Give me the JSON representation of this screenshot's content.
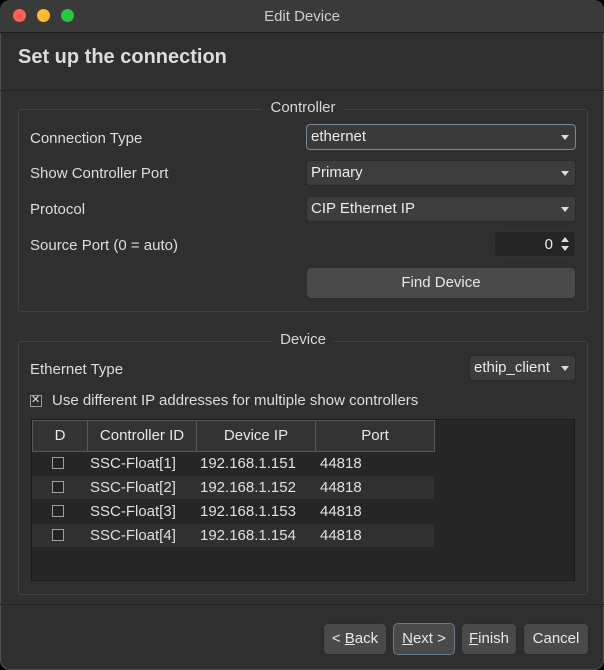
{
  "window": {
    "title": "Edit Device"
  },
  "page": {
    "title": "Set up the connection"
  },
  "controller": {
    "group_title": "Controller",
    "connection_type": {
      "label": "Connection Type",
      "value": "ethernet"
    },
    "show_controller_port": {
      "label": "Show Controller Port",
      "value": "Primary"
    },
    "protocol": {
      "label": "Protocol",
      "value": "CIP Ethernet IP"
    },
    "source_port": {
      "label": "Source Port (0 = auto)",
      "value": "0"
    },
    "find_device_label": "Find Device"
  },
  "device": {
    "group_title": "Device",
    "ethernet_type": {
      "label": "Ethernet Type",
      "value": "ethip_client"
    },
    "use_different_ip": {
      "label": "Use different IP addresses for multiple show controllers",
      "checked": true
    },
    "table": {
      "columns": [
        "D",
        "Controller ID",
        "Device IP",
        "Port"
      ],
      "rows": [
        {
          "checked": false,
          "controller_id": "SSC-Float[1]",
          "device_ip": "192.168.1.151",
          "port": "44818"
        },
        {
          "checked": false,
          "controller_id": "SSC-Float[2]",
          "device_ip": "192.168.1.152",
          "port": "44818"
        },
        {
          "checked": false,
          "controller_id": "SSC-Float[3]",
          "device_ip": "192.168.1.153",
          "port": "44818"
        },
        {
          "checked": false,
          "controller_id": "SSC-Float[4]",
          "device_ip": "192.168.1.154",
          "port": "44818"
        }
      ]
    }
  },
  "footer": {
    "back": {
      "prefix": "< ",
      "mnemonic": "B",
      "rest": "ack"
    },
    "next": {
      "mnemonic": "N",
      "rest": "ext >"
    },
    "finish": {
      "mnemonic": "F",
      "rest": "inish"
    },
    "cancel": "Cancel"
  }
}
